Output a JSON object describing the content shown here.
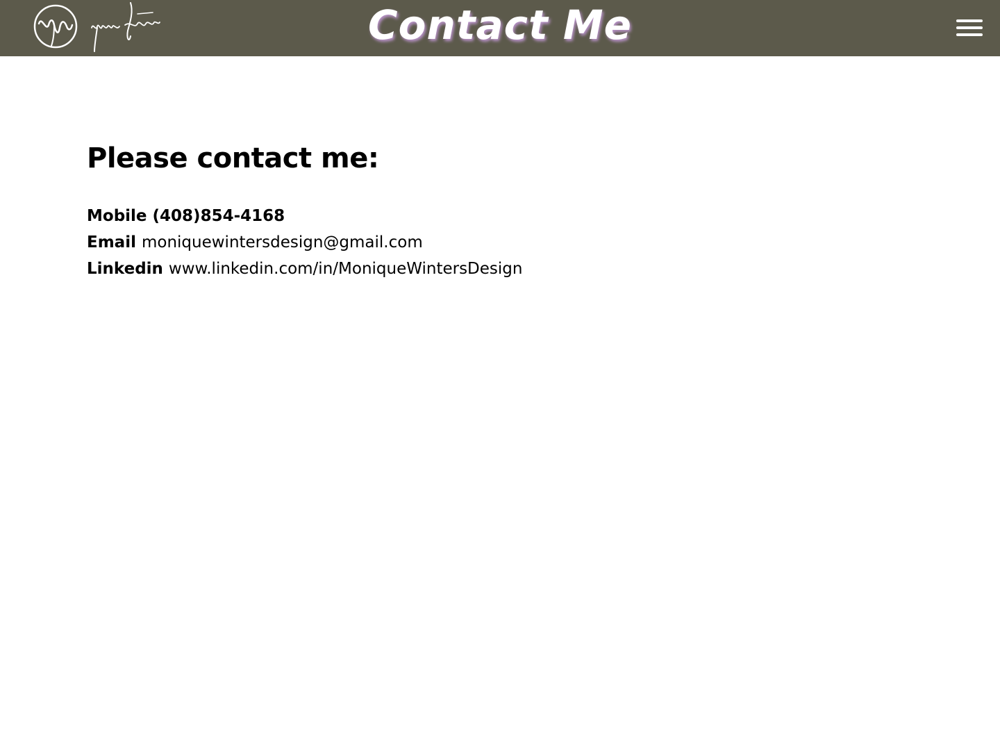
{
  "header": {
    "title": "Contact Me",
    "logo_icon": "monique-winters-signature-logo",
    "menu_icon": "hamburger-menu-icon",
    "background_color": "#5c5a4b",
    "title_shadow_color": "#b993c9"
  },
  "main": {
    "heading": "Please contact me:",
    "contacts": [
      {
        "label": "Mobile",
        "value": "(408)854-4168"
      },
      {
        "label": "Email",
        "value": "moniquewintersdesign@gmail.com"
      },
      {
        "label": "Linkedin",
        "value": "www.linkedin.com/in/MoniqueWintersDesign"
      }
    ]
  }
}
